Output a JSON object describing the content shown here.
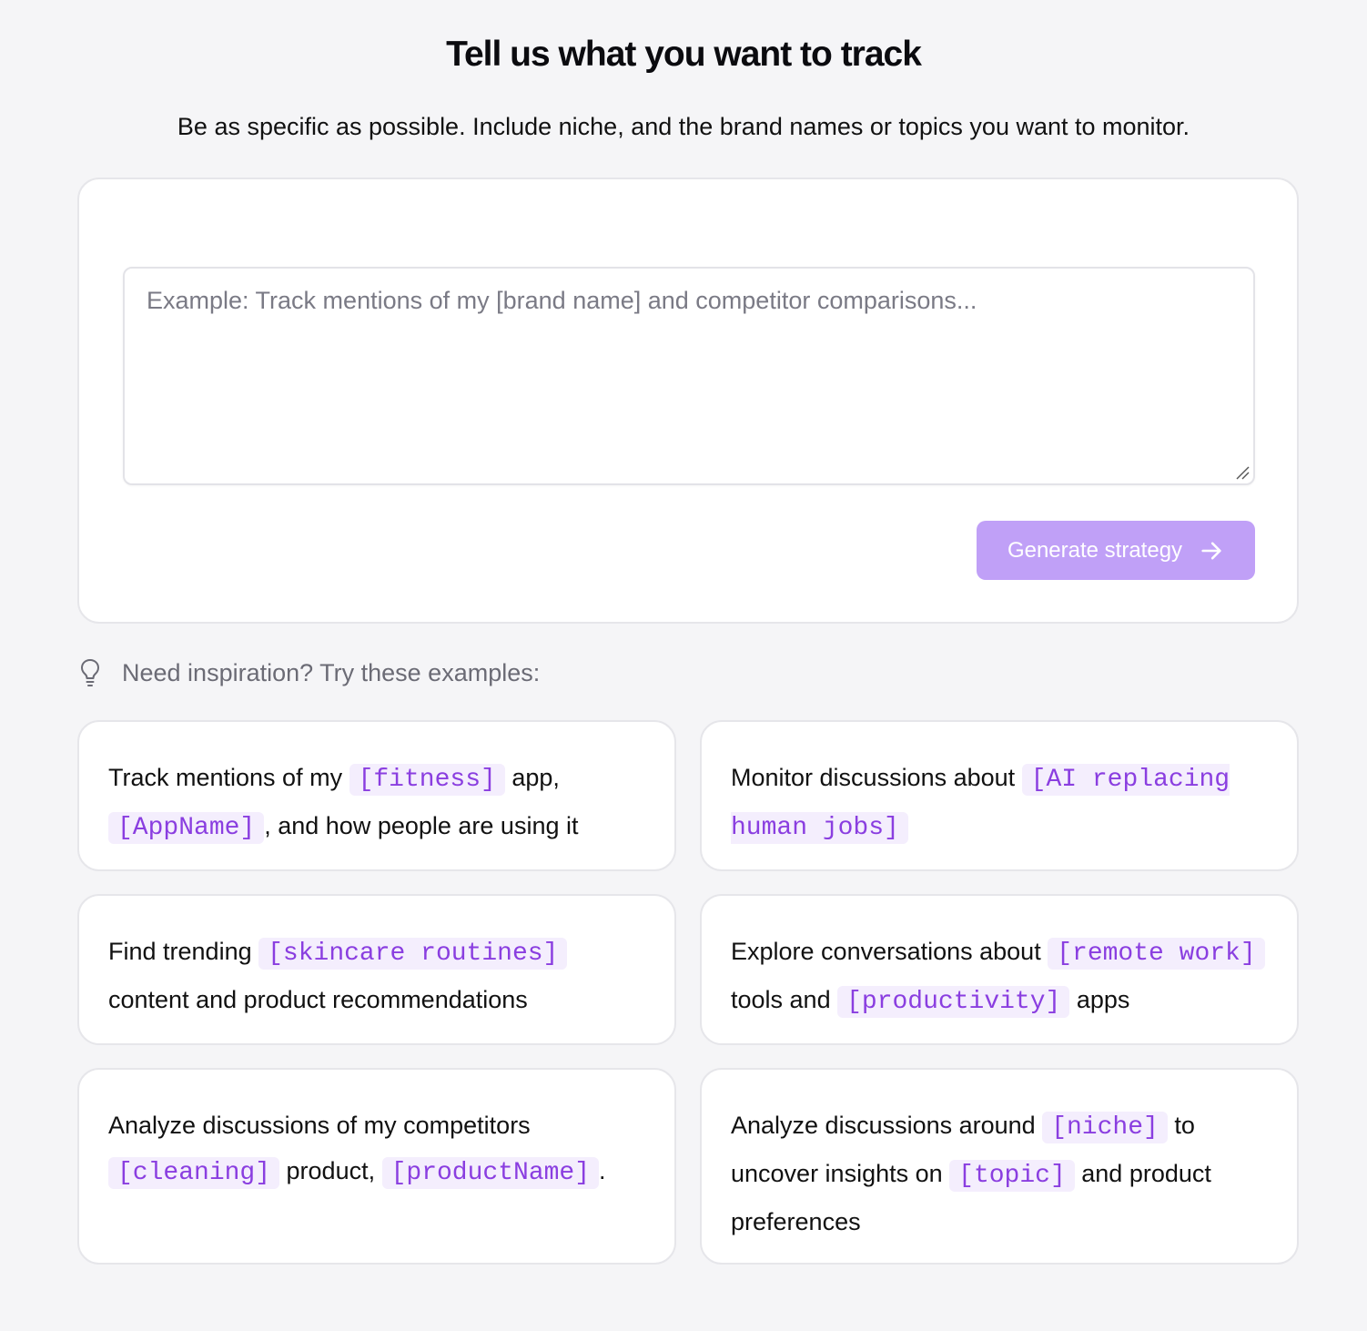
{
  "header": {
    "title": "Tell us what you want to track",
    "subtitle": "Be as specific as possible. Include niche, and the brand names or topics you want to monitor."
  },
  "form": {
    "placeholder": "Example: Track mentions of my [brand name] and competitor comparisons...",
    "value": "",
    "submit_label": "Generate strategy",
    "submit_icon": "arrow-right-icon",
    "accent_color": "#c0a0f7"
  },
  "inspiration": {
    "icon": "lightbulb-icon",
    "label": "Need inspiration? Try these examples:",
    "examples": [
      {
        "segments": [
          {
            "text": "Track mentions of my ",
            "token": false
          },
          {
            "text": "[fitness]",
            "token": true
          },
          {
            "text": " app, ",
            "token": false
          },
          {
            "text": "[AppName]",
            "token": true
          },
          {
            "text": ", and how people are using it",
            "token": false
          }
        ]
      },
      {
        "segments": [
          {
            "text": "Monitor discussions about ",
            "token": false
          },
          {
            "text": "[AI replacing human jobs]",
            "token": true
          }
        ]
      },
      {
        "segments": [
          {
            "text": "Find trending ",
            "token": false
          },
          {
            "text": "[skincare routines]",
            "token": true
          },
          {
            "text": " content and product recommendations",
            "token": false
          }
        ]
      },
      {
        "segments": [
          {
            "text": "Explore conversations about ",
            "token": false
          },
          {
            "text": "[remote work]",
            "token": true
          },
          {
            "text": " tools and ",
            "token": false
          },
          {
            "text": "[productivity]",
            "token": true
          },
          {
            "text": " apps",
            "token": false
          }
        ]
      },
      {
        "segments": [
          {
            "text": "Analyze discussions of my competitors ",
            "token": false
          },
          {
            "text": "[cleaning]",
            "token": true
          },
          {
            "text": " product, ",
            "token": false
          },
          {
            "text": "[productName]",
            "token": true
          },
          {
            "text": ".",
            "token": false
          }
        ]
      },
      {
        "segments": [
          {
            "text": "Analyze discussions around ",
            "token": false
          },
          {
            "text": "[niche]",
            "token": true
          },
          {
            "text": " to uncover insights on ",
            "token": false
          },
          {
            "text": "[topic]",
            "token": true
          },
          {
            "text": " and product preferences",
            "token": false
          }
        ]
      }
    ]
  }
}
